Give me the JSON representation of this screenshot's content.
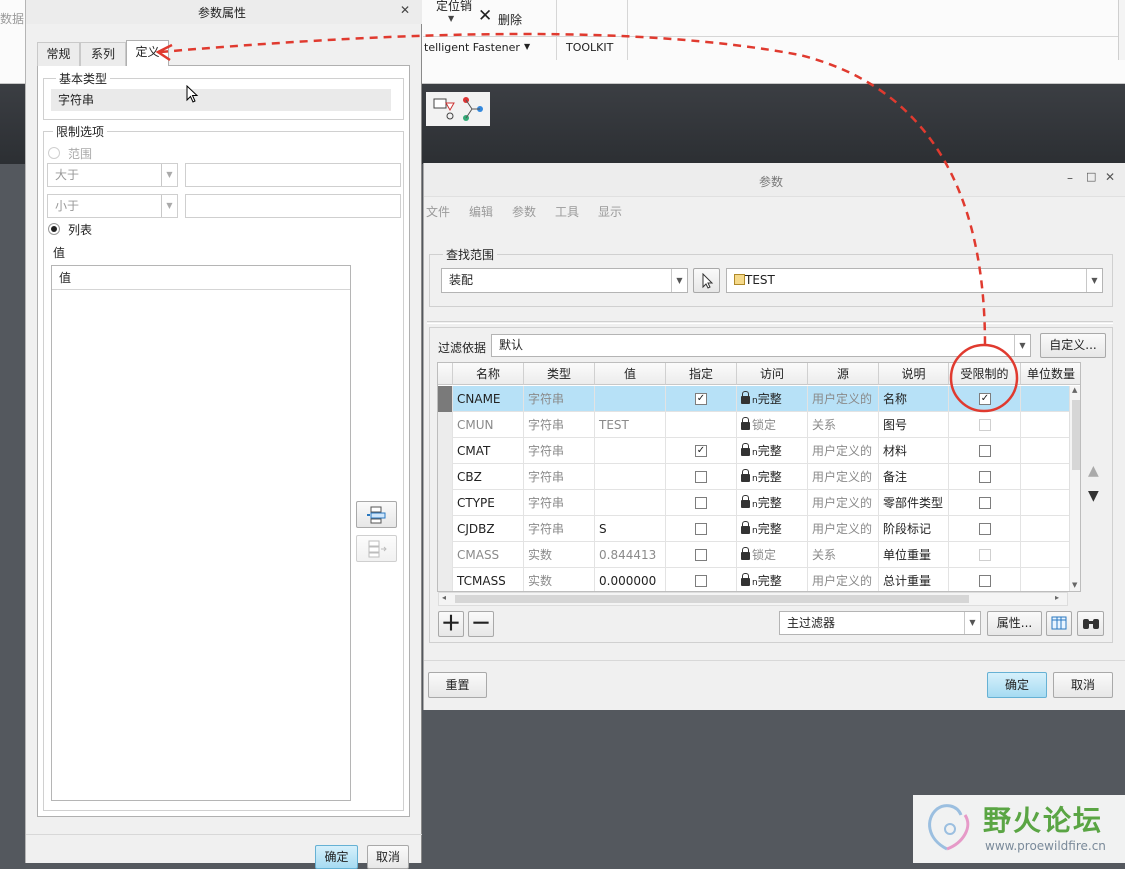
{
  "background": {
    "left_cut_text": "数据",
    "ribbon_items": [
      "定位销",
      "删除"
    ],
    "fastener_label": "telligent Fastener",
    "toolkit_label": "TOOLKIT"
  },
  "params_dialog": {
    "title": "参数",
    "menu": [
      "文件",
      "编辑",
      "参数",
      "工具",
      "显示"
    ],
    "search_scope_label": "查找范围",
    "scope_value": "装配",
    "model_value": "TEST",
    "filter_label": "过滤依据",
    "filter_value": "默认",
    "customize_button": "自定义...",
    "columns": [
      "名称",
      "类型",
      "值",
      "指定",
      "访问",
      "源",
      "说明",
      "受限制的",
      "单位数量"
    ],
    "rows": [
      {
        "name": "CNAME",
        "type": "字符串",
        "value": "",
        "designated": true,
        "access": "完整",
        "access_mark": "n",
        "source": "用户定义的",
        "desc": "名称",
        "restricted": true,
        "restricted_disabled": false,
        "dim": false,
        "selected": true
      },
      {
        "name": "CMUN",
        "type": "字符串",
        "value": "TEST",
        "designated": null,
        "access": "锁定",
        "access_mark": "",
        "source": "关系",
        "desc": "图号",
        "restricted": false,
        "restricted_disabled": true,
        "dim": true,
        "selected": false
      },
      {
        "name": "CMAT",
        "type": "字符串",
        "value": "",
        "designated": true,
        "access": "完整",
        "access_mark": "n",
        "source": "用户定义的",
        "desc": "材料",
        "restricted": false,
        "restricted_disabled": false,
        "dim": false,
        "selected": false
      },
      {
        "name": "CBZ",
        "type": "字符串",
        "value": "",
        "designated": false,
        "access": "完整",
        "access_mark": "n",
        "source": "用户定义的",
        "desc": "备注",
        "restricted": false,
        "restricted_disabled": false,
        "dim": false,
        "selected": false
      },
      {
        "name": "CTYPE",
        "type": "字符串",
        "value": "",
        "designated": false,
        "access": "完整",
        "access_mark": "n",
        "source": "用户定义的",
        "desc": "零部件类型",
        "restricted": false,
        "restricted_disabled": false,
        "dim": false,
        "selected": false
      },
      {
        "name": "CJDBZ",
        "type": "字符串",
        "value": "S",
        "designated": false,
        "access": "完整",
        "access_mark": "n",
        "source": "用户定义的",
        "desc": "阶段标记",
        "restricted": false,
        "restricted_disabled": false,
        "dim": false,
        "selected": false
      },
      {
        "name": "CMASS",
        "type": "实数",
        "value": "0.844413",
        "designated": false,
        "access": "锁定",
        "access_mark": "",
        "source": "关系",
        "desc": "单位重量",
        "restricted": false,
        "restricted_disabled": true,
        "dim": true,
        "selected": false
      },
      {
        "name": "TCMASS",
        "type": "实数",
        "value": "0.000000",
        "designated": false,
        "access": "完整",
        "access_mark": "n",
        "source": "用户定义的",
        "desc": "总计重量",
        "restricted": false,
        "restricted_disabled": false,
        "dim": false,
        "selected": false
      }
    ],
    "main_filter_value": "主过滤器",
    "properties_button": "属性...",
    "reset_button": "重置",
    "ok_button": "确定",
    "cancel_button": "取消"
  },
  "props_dialog": {
    "title": "参数属性",
    "tabs": [
      "常规",
      "系列",
      "定义"
    ],
    "basic_type_label": "基本类型",
    "basic_type_value": "字符串",
    "limit_options_label": "限制选项",
    "range_option": "范围",
    "greater_than": "大于",
    "less_than": "小于",
    "list_option": "列表",
    "value_label": "值",
    "list_header": "值",
    "ok_button": "确定",
    "cancel_button": "取消"
  },
  "watermark": {
    "title": "野火论坛",
    "url": "www.proewildfire.cn"
  },
  "colors": {
    "accent_blue": "#b7e1f7",
    "annotation_red": "#e03a2f",
    "watermark_green": "#5aa544"
  }
}
